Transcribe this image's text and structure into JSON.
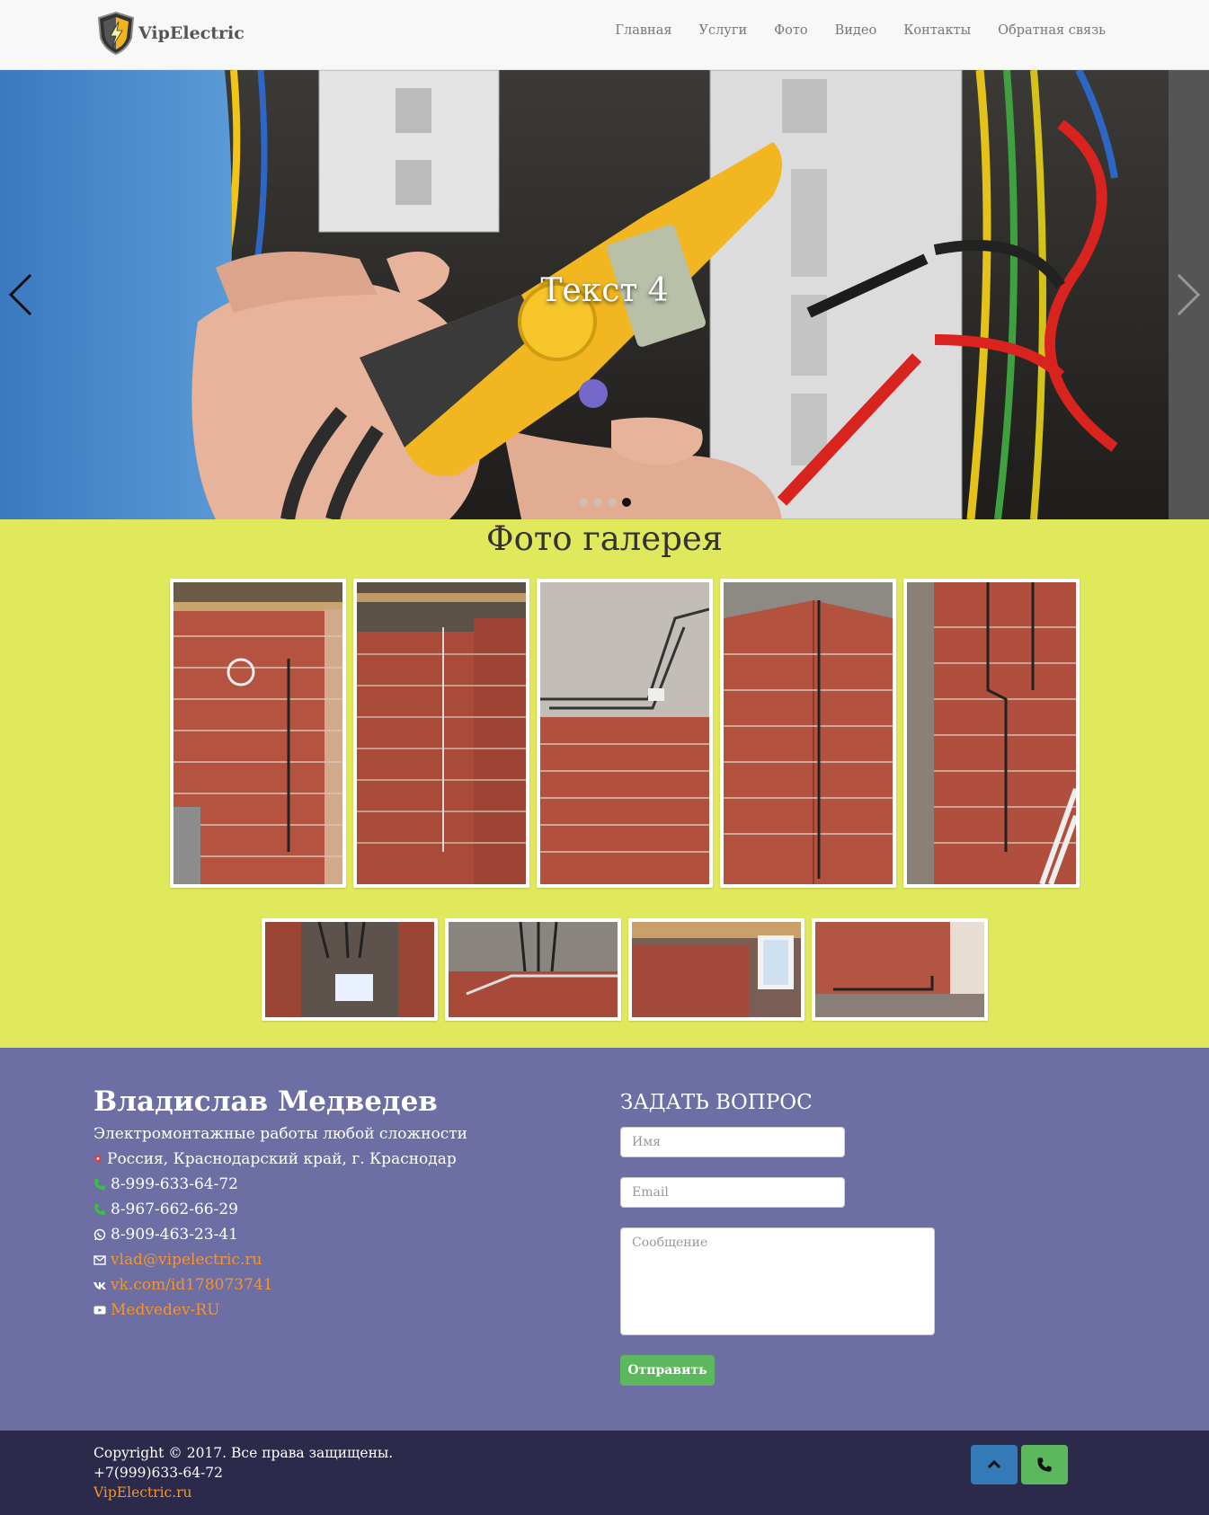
{
  "brand": {
    "name": "VipElectric",
    "icon": "shield-lightning-icon"
  },
  "nav": {
    "items": [
      "Главная",
      "Услуги",
      "Фото",
      "Видео",
      "Контакты",
      "Обратная связь"
    ]
  },
  "carousel": {
    "caption": "Текст 4",
    "slide_count": 4,
    "active_index": 3
  },
  "gallery": {
    "title": "Фото галерея"
  },
  "contact": {
    "name": "Владислав Медведев",
    "tagline": "Электромонтажные работы любой сложности",
    "address": "Россия, Краснодарский край, г. Краснодар",
    "phone1": "8-999-633-64-72",
    "phone2": "8-967-662-66-29",
    "whatsapp": "8-909-463-23-41",
    "email": "vlad@vipelectric.ru",
    "vk": "vk.com/id178073741",
    "youtube": "Medvedev-RU"
  },
  "form": {
    "title": "ЗАДАТЬ ВОПРОС",
    "name_placeholder": "Имя",
    "email_placeholder": "Email",
    "message_placeholder": "Сообщение",
    "submit_label": "Отправить"
  },
  "footer": {
    "copyright": "Copyright © 2017. Все права защищены.",
    "phone": "+7(999)633-64-72",
    "site": "VipElectric.ru"
  },
  "colors": {
    "gallery_bg": "#e0e85c",
    "contact_bg": "#6c6ea4",
    "footer_bg": "#2b2a4a",
    "link": "#f5952b",
    "button_green": "#5cb85c",
    "button_blue": "#337ab7"
  }
}
